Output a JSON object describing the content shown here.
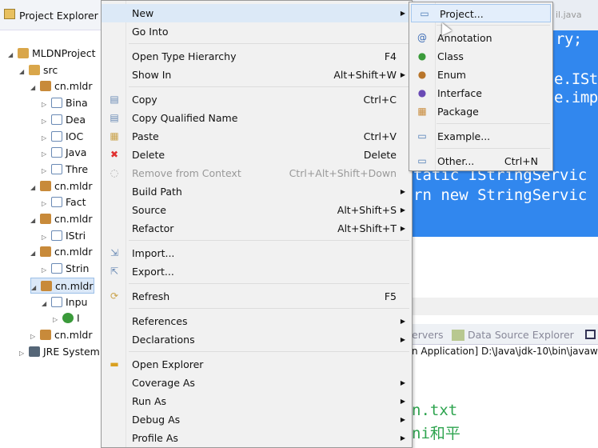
{
  "explorer": {
    "title": "Project Explorer",
    "tree": [
      {
        "label": "MLDNProject",
        "icon": "project-icon",
        "indent": 1,
        "expanded": true
      },
      {
        "label": "src",
        "icon": "source-folder-icon",
        "indent": 2,
        "expanded": true
      },
      {
        "label": "cn.mldr",
        "icon": "package-icon",
        "indent": 3,
        "expanded": true
      },
      {
        "label": "Bina",
        "icon": "java-file-icon",
        "indent": 4,
        "expanded": false
      },
      {
        "label": "Dea",
        "icon": "java-file-icon",
        "indent": 4,
        "expanded": false
      },
      {
        "label": "IOC",
        "icon": "java-file-icon",
        "indent": 4,
        "expanded": false
      },
      {
        "label": "Java",
        "icon": "java-file-icon",
        "indent": 4,
        "expanded": false
      },
      {
        "label": "Thre",
        "icon": "java-file-icon",
        "indent": 4,
        "expanded": false
      },
      {
        "label": "cn.mldr",
        "icon": "package-icon",
        "indent": 3,
        "expanded": true
      },
      {
        "label": "Fact",
        "icon": "java-file-icon",
        "indent": 4,
        "expanded": false
      },
      {
        "label": "cn.mldr",
        "icon": "package-icon",
        "indent": 3,
        "expanded": true
      },
      {
        "label": "IStri",
        "icon": "java-file-icon",
        "indent": 4,
        "expanded": false
      },
      {
        "label": "cn.mldr",
        "icon": "package-icon",
        "indent": 3,
        "expanded": true
      },
      {
        "label": "Strin",
        "icon": "java-file-icon",
        "indent": 4,
        "expanded": false
      },
      {
        "label": "cn.mldr",
        "icon": "package-icon",
        "indent": 3,
        "expanded": true,
        "selected": true
      },
      {
        "label": "Inpu",
        "icon": "java-file-icon",
        "indent": 4,
        "expanded": true
      },
      {
        "label": "I",
        "icon": "class-icon",
        "indent": 5,
        "expanded": false
      },
      {
        "label": "cn.mldr",
        "icon": "package-icon",
        "indent": 3,
        "expanded": false
      },
      {
        "label": "JRE System",
        "icon": "library-icon",
        "indent": 2,
        "expanded": false
      }
    ]
  },
  "editor": {
    "tab": "il.java",
    "code": [
      "ry;",
      "e.ISt",
      "e.imp",
      "tatic IStringServic",
      "rn new StringServic"
    ],
    "panel_tabs": [
      "ervers",
      "Data Source Explorer"
    ],
    "console_header": "n Application] D:\\Java\\jdk-10\\bin\\javaw",
    "console_output": [
      "n.txt",
      "ni和平"
    ]
  },
  "context_menu": [
    {
      "label": "New",
      "submenu": true,
      "highlighted": true
    },
    {
      "label": "Go Into"
    },
    {
      "sep": true
    },
    {
      "label": "Open Type Hierarchy",
      "shortcut": "F4"
    },
    {
      "label": "Show In",
      "shortcut": "Alt+Shift+W",
      "submenu": true
    },
    {
      "sep": true
    },
    {
      "label": "Copy",
      "shortcut": "Ctrl+C",
      "icon": "copy-icon"
    },
    {
      "label": "Copy Qualified Name",
      "icon": "copy-qualified-name-icon"
    },
    {
      "label": "Paste",
      "shortcut": "Ctrl+V",
      "icon": "paste-icon"
    },
    {
      "label": "Delete",
      "shortcut": "Delete",
      "icon": "delete-icon"
    },
    {
      "label": "Remove from Context",
      "shortcut": "Ctrl+Alt+Shift+Down",
      "disabled": true,
      "icon": "remove-context-icon"
    },
    {
      "label": "Build Path",
      "submenu": true
    },
    {
      "label": "Source",
      "shortcut": "Alt+Shift+S",
      "submenu": true
    },
    {
      "label": "Refactor",
      "shortcut": "Alt+Shift+T",
      "submenu": true
    },
    {
      "sep": true
    },
    {
      "label": "Import...",
      "icon": "import-icon"
    },
    {
      "label": "Export...",
      "icon": "export-icon"
    },
    {
      "sep": true
    },
    {
      "label": "Refresh",
      "shortcut": "F5",
      "icon": "refresh-icon"
    },
    {
      "sep": true
    },
    {
      "label": "References",
      "submenu": true
    },
    {
      "label": "Declarations",
      "submenu": true
    },
    {
      "sep": true
    },
    {
      "label": "Open Explorer",
      "icon": "folder-icon"
    },
    {
      "label": "Coverage As",
      "submenu": true
    },
    {
      "label": "Run As",
      "submenu": true
    },
    {
      "label": "Debug As",
      "submenu": true
    },
    {
      "label": "Profile As",
      "submenu": true
    }
  ],
  "new_submenu": [
    {
      "label": "Project...",
      "icon": "new-project-icon",
      "highlighted": true
    },
    {
      "sep": true
    },
    {
      "label": "Annotation",
      "icon": "annotation-icon"
    },
    {
      "label": "Class",
      "icon": "class-icon"
    },
    {
      "label": "Enum",
      "icon": "enum-icon"
    },
    {
      "label": "Interface",
      "icon": "interface-icon"
    },
    {
      "label": "Package",
      "icon": "package-icon"
    },
    {
      "sep": true
    },
    {
      "label": "Example...",
      "icon": "new-example-icon"
    },
    {
      "sep": true
    },
    {
      "label": "Other...",
      "shortcut": "Ctrl+N",
      "icon": "new-wizard-icon"
    }
  ],
  "colors": {
    "selection": "#3187ee",
    "menu_bg": "#f1f1f1",
    "console_green": "#2ea44f"
  }
}
